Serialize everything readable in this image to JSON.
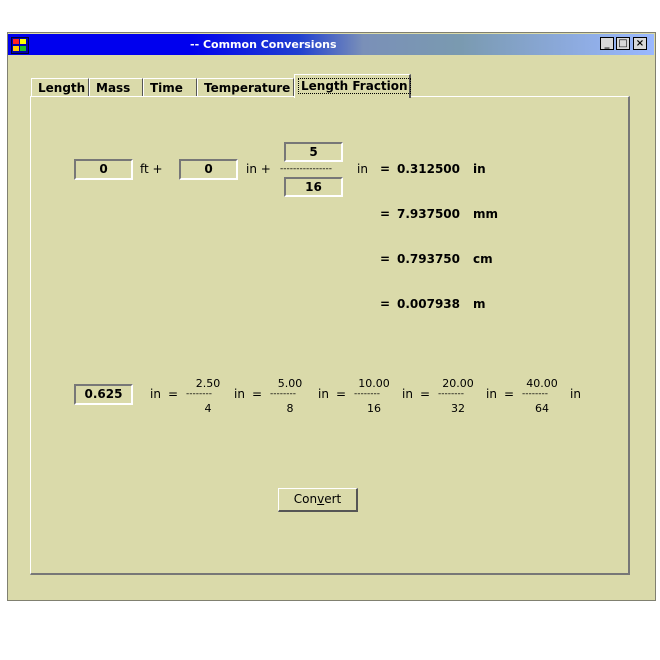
{
  "window": {
    "title": "-- Common Conversions",
    "min_glyph": "_",
    "max_glyph": "□",
    "close_glyph": "×"
  },
  "tabs": [
    {
      "label": "Length"
    },
    {
      "label": "Mass"
    },
    {
      "label": "Time"
    },
    {
      "label": "Temperature"
    },
    {
      "label": "Length Fraction",
      "active": true
    }
  ],
  "length_input": {
    "feet_value": "0",
    "feet_unit": "ft +",
    "inch_value": "0",
    "inch_unit": "in +",
    "numerator": "5",
    "denominator": "16",
    "fraction_bar": "----------------",
    "fraction_unit": "in"
  },
  "results": [
    {
      "eq": "=",
      "value": "0.312500",
      "unit": "in"
    },
    {
      "eq": "=",
      "value": "7.937500",
      "unit": "mm"
    },
    {
      "eq": "=",
      "value": "0.793750",
      "unit": "cm"
    },
    {
      "eq": "=",
      "value": "0.007938",
      "unit": "m"
    }
  ],
  "decimal_input": {
    "value": "0.625",
    "unit": "in",
    "eq": "=",
    "bar": "--------",
    "fractions": [
      {
        "numerator": "2.50",
        "denominator": "4",
        "unit": "in",
        "eq": "="
      },
      {
        "numerator": "5.00",
        "denominator": "8",
        "unit": "in",
        "eq": "="
      },
      {
        "numerator": "10.00",
        "denominator": "16",
        "unit": "in",
        "eq": "="
      },
      {
        "numerator": "20.00",
        "denominator": "32",
        "unit": "in",
        "eq": "="
      },
      {
        "numerator": "40.00",
        "denominator": "64",
        "unit": "in"
      }
    ]
  },
  "convert_button": {
    "label_pre": "Con",
    "label_underlined": "v",
    "label_post": "ert"
  }
}
